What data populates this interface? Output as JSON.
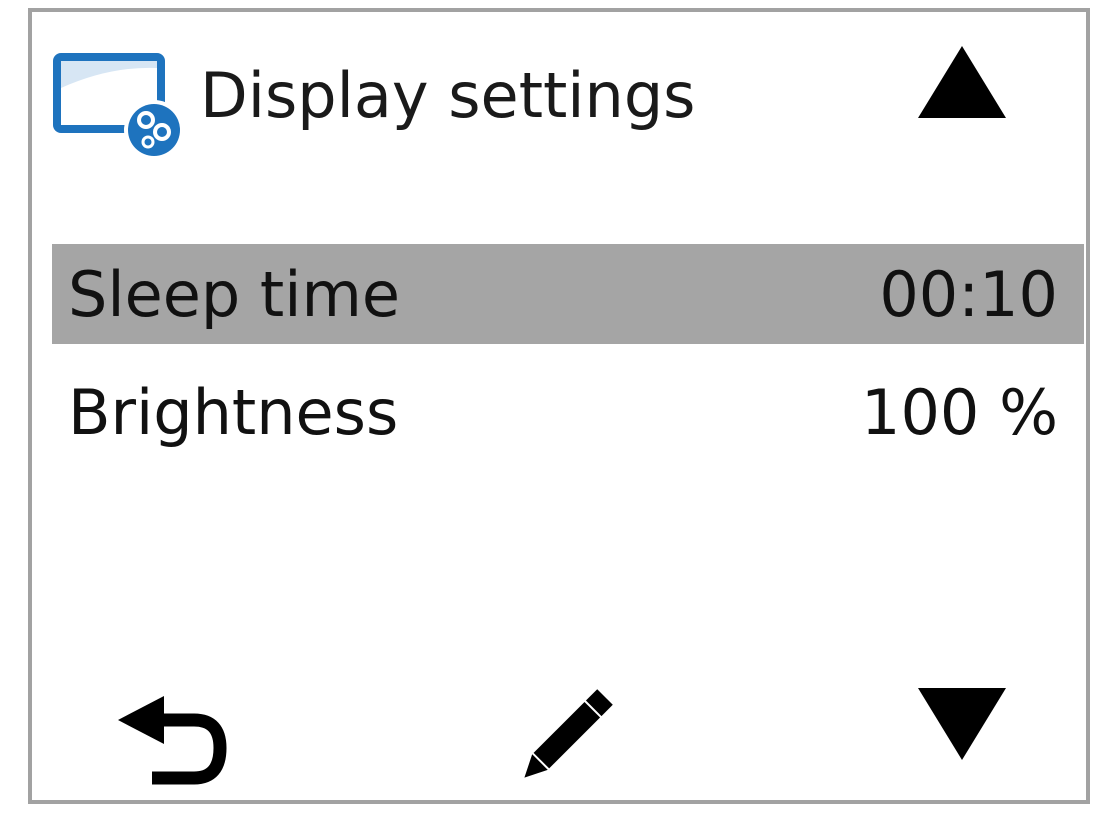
{
  "header": {
    "title": "Display settings",
    "icon": "display-settings-icon",
    "icon_color": "#1e73be"
  },
  "list": {
    "items": [
      {
        "label": "Sleep time",
        "value": "00:10",
        "selected": true
      },
      {
        "label": "Brightness",
        "value": "100 %",
        "selected": false
      }
    ]
  },
  "navigation": {
    "up_icon": "triangle-up-icon",
    "down_icon": "triangle-down-icon",
    "back_icon": "back-arrow-icon",
    "edit_icon": "pencil-icon"
  },
  "colors": {
    "selected_row": "#a5a5a5",
    "frame_border": "#a2a2a2",
    "icon_blue": "#1e73be"
  }
}
